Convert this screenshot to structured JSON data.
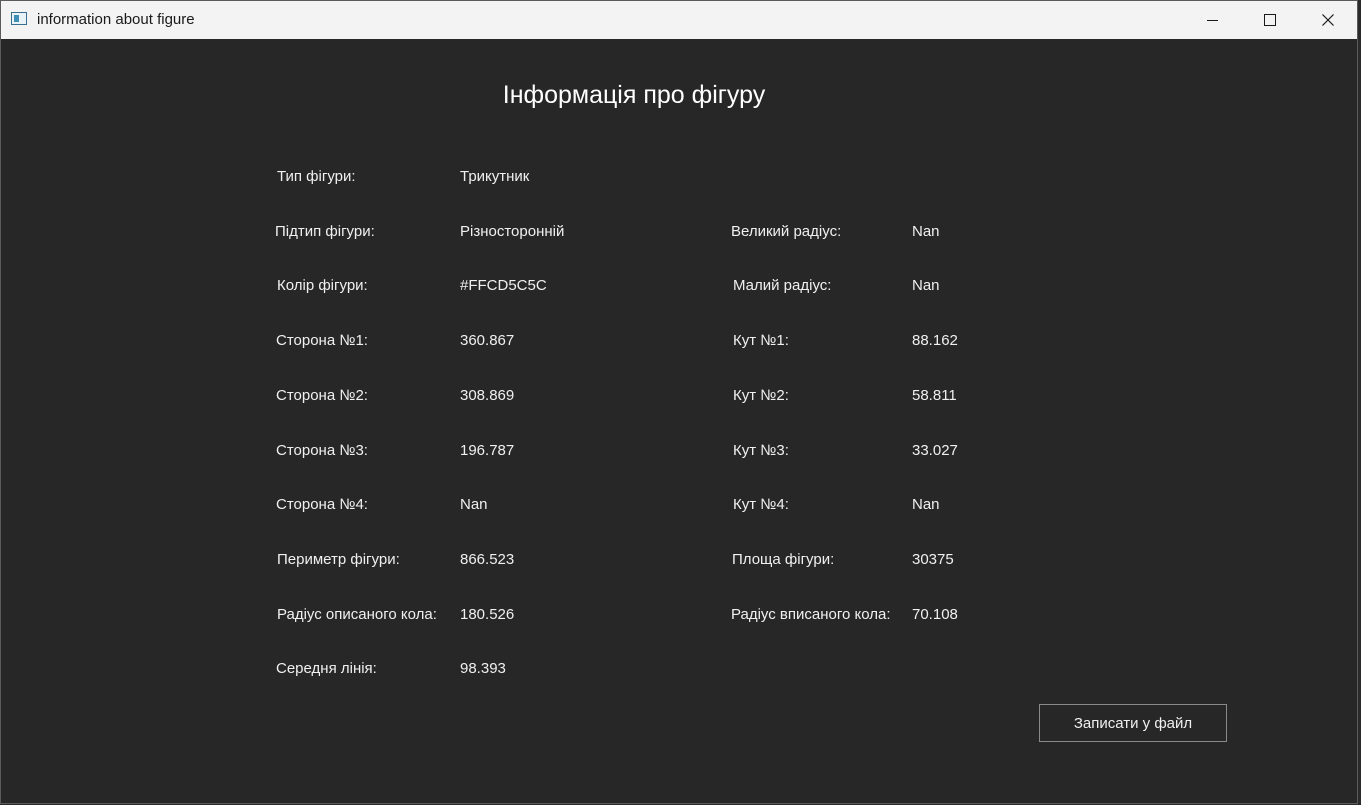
{
  "window": {
    "title": "information about figure"
  },
  "heading": "Інформація про фігуру",
  "left_rows": [
    {
      "label": "Тип фігури:",
      "value": "Трикутник"
    },
    {
      "label": "Підтип фігури:",
      "value": "Різносторонній"
    },
    {
      "label": "Колір фігури:",
      "value": "#FFCD5C5C"
    },
    {
      "label": "Сторона №1:",
      "value": "360.867"
    },
    {
      "label": "Сторона №2:",
      "value": "308.869"
    },
    {
      "label": "Сторона №3:",
      "value": "196.787"
    },
    {
      "label": "Сторона №4:",
      "value": "Nan"
    },
    {
      "label": "Периметр фігури:",
      "value": "866.523"
    },
    {
      "label": "Радіус описаного кола:",
      "value": "180.526"
    },
    {
      "label": "Середня лінія:",
      "value": "98.393"
    }
  ],
  "right_rows": [
    {
      "label": "Великий радіус:",
      "value": "Nan"
    },
    {
      "label": "Малий радіус:",
      "value": "Nan"
    },
    {
      "label": "Кут №1:",
      "value": "88.162"
    },
    {
      "label": "Кут №2:",
      "value": "58.811"
    },
    {
      "label": "Кут №3:",
      "value": "33.027"
    },
    {
      "label": "Кут №4:",
      "value": "Nan"
    },
    {
      "label": "Площа фігури:",
      "value": "30375"
    },
    {
      "label": "Радіус вписаного кола:",
      "value": "70.108"
    }
  ],
  "save_button": "Записати у файл",
  "colors": {
    "background": "#272727",
    "titlebar": "#f3f3f3",
    "text": "#f0f0f0"
  },
  "icons": {
    "app": "app-window-icon",
    "minimize": "minimize-icon",
    "maximize": "maximize-icon",
    "close": "close-icon"
  }
}
